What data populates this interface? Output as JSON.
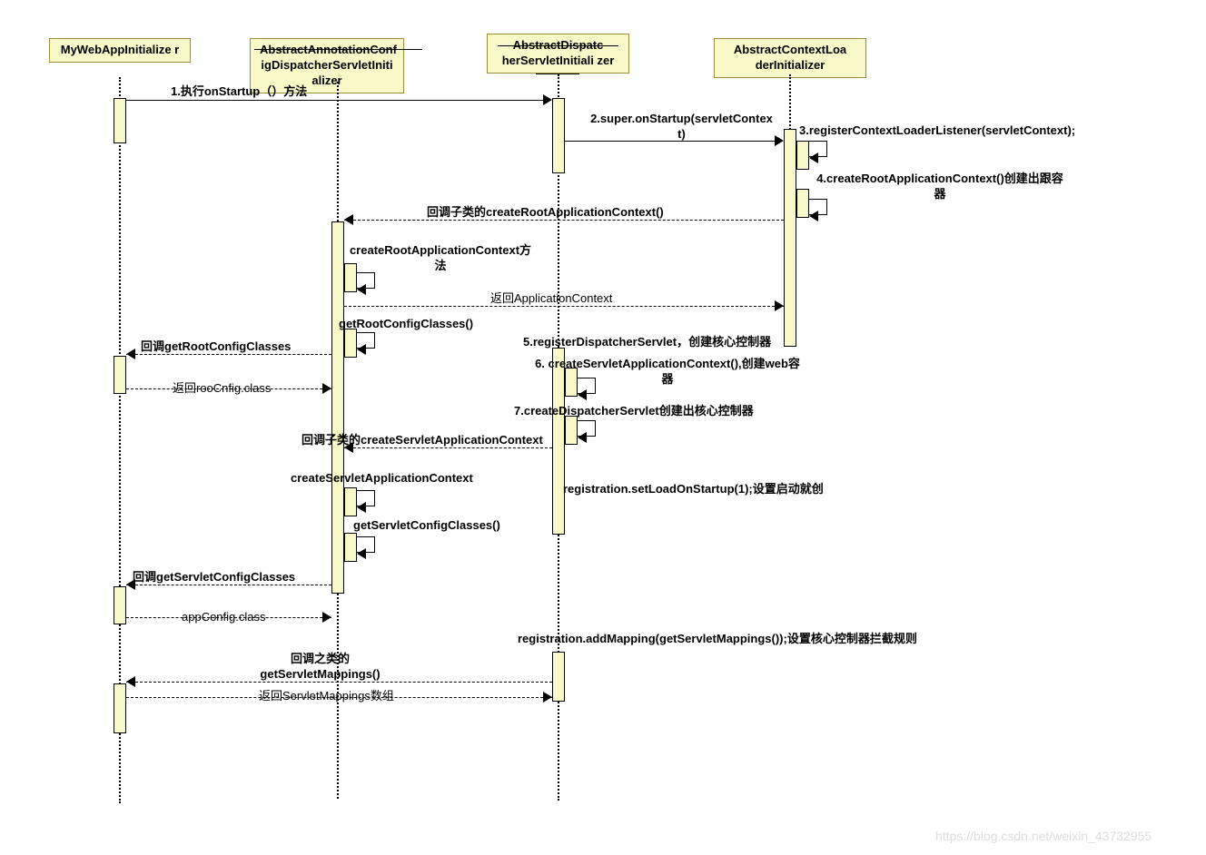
{
  "participants": {
    "p1": "MyWebAppInitialize\nr",
    "p2": "AbstractAnnotationConf\nigDispatcherServletIniti\nalizer",
    "p3": "AbstractDispatc\nherServletInitiali\nzer",
    "p4": "AbstractContextLoa\nderInitializer"
  },
  "messages": {
    "m1": "1.执行onStartup（）方法",
    "m2": "2.super.onStartup(servletContex\nt)",
    "m3": "3.registerContextLoaderListener(servletContext);",
    "m4": "4.createRootApplicationContext()创建出跟容\n器",
    "m5": "回调子类的createRootApplicationContext()",
    "m6": "createRootApplicationContext方\n法",
    "m7": "返回ApplicationContext",
    "m8": "getRootConfigClasses()",
    "m9": "回调getRootConfigClasses",
    "m10": "返回rooCnfig.class",
    "m11": "5.registerDispatcherServlet，创建核心控制器",
    "m12": "6. createServletApplicationContext(),创建web容\n器",
    "m13": "7.createDispatcherServlet创建出核心控制器",
    "m14": "回调子类的createServletApplicationContext",
    "m15": "createServletApplicationContext",
    "m16": "registration.setLoadOnStartup(1);设置启动就创",
    "m17": "getServletConfigClasses()",
    "m18": "回调getServletConfigClasses",
    "m19": "appConfig.class",
    "m20": "registration.addMapping(getServletMappings());设置核心控制器拦截规则",
    "m21": "回调之类的\ngetServletMappings()",
    "m22": "返回ServletMappings数组"
  },
  "watermark": "https://blog.csdn.net/weixin_43732955"
}
